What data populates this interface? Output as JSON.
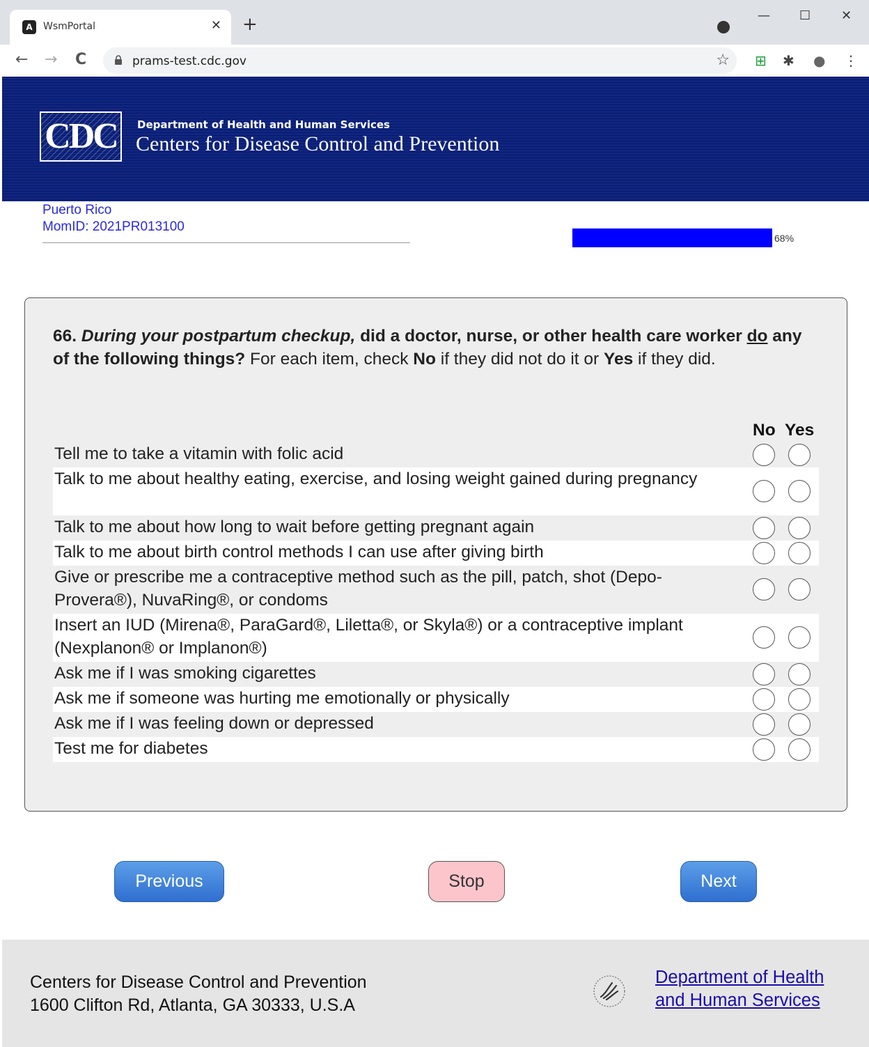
{
  "browser": {
    "tab_title": "WsmPortal",
    "tab_close": "✕",
    "new_tab": "+",
    "win_min": "—",
    "win_max": "☐",
    "win_close": "✕",
    "back": "←",
    "forward": "→",
    "reload": "C",
    "url": "prams-test.cdc.gov",
    "star": "☆",
    "ext_spreadsheet": "⊞",
    "ext_puzzle": "✱",
    "ext_account": "●",
    "ext_menu": "⋮",
    "icons": [
      "angular-favicon-icon",
      "lock-icon",
      "star-icon",
      "puzzle-icon",
      "account-icon",
      "menu-icon"
    ]
  },
  "header": {
    "logo_text": "CDC",
    "dept_line": "Department of Health and Human Services",
    "agency_name": "Centers for Disease Control and Prevention",
    "bg_color": "#0a1f78"
  },
  "respondent": {
    "location": "Puerto Rico",
    "mom_id": "MomID: 2021PR013100"
  },
  "progress": {
    "percent_label": "68%",
    "color": "#0000ff"
  },
  "question": {
    "number": "66.",
    "emph": "During your postpartum checkup,",
    "bold1": " did a doctor, nurse, or other health care worker ",
    "underlined": "do",
    "bold2": " any of the following things?",
    "plain1": " For each item, check ",
    "no_word": "No",
    "plain2": " if they did not do it or ",
    "yes_word": "Yes",
    "plain3": " if they did."
  },
  "columns": {
    "no": "No",
    "yes": "Yes"
  },
  "items": [
    {
      "label": "Tell me to take a vitamin with folic acid"
    },
    {
      "label": "Talk to me about healthy eating, exercise, and losing weight gained during pregnancy"
    },
    {
      "label": "Talk to me about how long to wait before getting pregnant again"
    },
    {
      "label": "Talk to me about birth control methods I can use after giving birth"
    },
    {
      "label": "Give or prescribe me a contraceptive method such as the pill, patch, shot (Depo-Provera®), NuvaRing®, or condoms"
    },
    {
      "label": "Insert an IUD (Mirena®, ParaGard®, Liletta®, or Skyla®) or a contraceptive implant (Nexplanon® or Implanon®)"
    },
    {
      "label": "Ask me if I was smoking cigarettes"
    },
    {
      "label": "Ask me if someone was hurting me emotionally or physically"
    },
    {
      "label": "Ask me if I was feeling down or depressed"
    },
    {
      "label": "Test me for diabetes"
    }
  ],
  "buttons": {
    "previous": "Previous",
    "stop": "Stop",
    "next": "Next"
  },
  "footer": {
    "org_name": "Centers for Disease Control and Prevention",
    "address": "1600 Clifton Rd, Atlanta, GA 30333, U.S.A",
    "link_line1": "Department of Health",
    "link_line2": "and Human Services"
  }
}
